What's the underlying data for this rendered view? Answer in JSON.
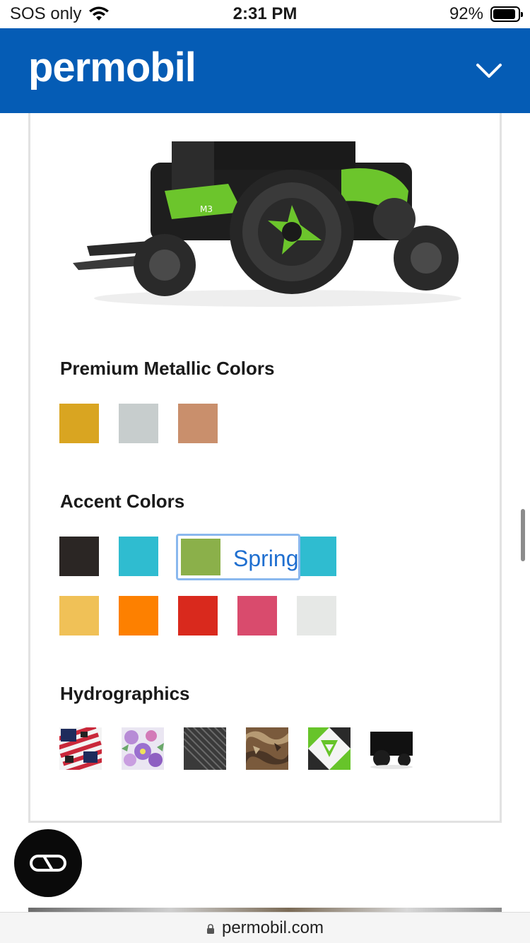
{
  "status_bar": {
    "carrier": "SOS only",
    "time": "2:31 PM",
    "battery": "92%",
    "battery_level": 0.92
  },
  "header": {
    "logo": "permobil",
    "menu_icon": "chevron-down-icon",
    "color": "#055cb5"
  },
  "product": {
    "badge": "M3"
  },
  "sections": {
    "premium_title": "Premium Metallic Colors",
    "accent_title": "Accent Colors",
    "hydro_title": "Hydrographics"
  },
  "premium_colors": [
    "#d9a521",
    "#c7cdcd",
    "#c98f6c"
  ],
  "accent_colors_row1": [
    "#2b2624",
    "#2fbcd0",
    "#8bb04a",
    "#6838b6",
    "#2fbcd0"
  ],
  "accent_colors_row2": [
    "#f0c157",
    "#fd8000",
    "#d9291d",
    "#d94b6d",
    "#e6e8e6"
  ],
  "tooltip": {
    "label": "Spring",
    "color": "#8bb04a"
  },
  "hydrographics": [
    "american-flag-pattern",
    "floral-pattern",
    "carbon-fiber-pattern",
    "camo-pattern",
    "green-geometric-pattern",
    "black-chair-pattern"
  ],
  "chat": {
    "icon": "chat-loop-icon"
  },
  "url_bar": {
    "domain": "permobil.com",
    "icon": "lock-icon"
  }
}
